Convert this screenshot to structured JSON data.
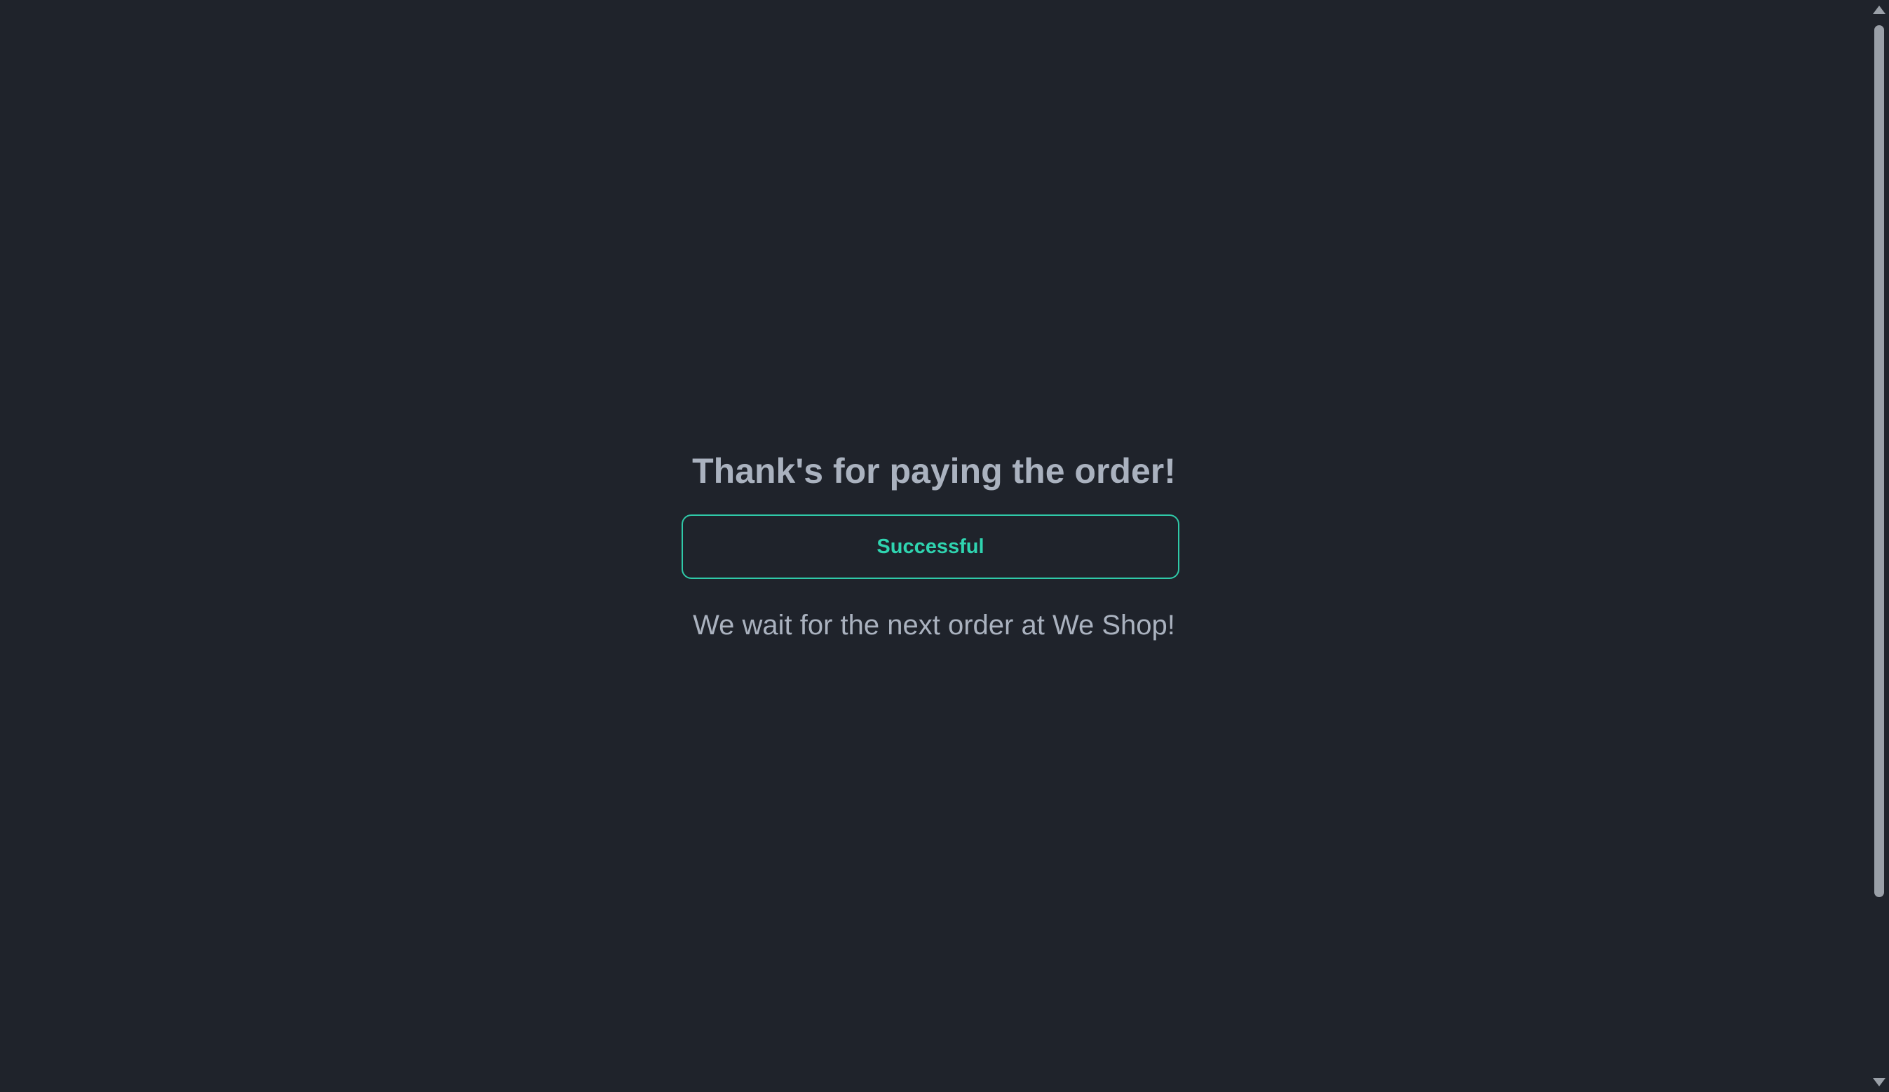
{
  "main": {
    "heading": "Thank's for paying the order!",
    "status": "Successful",
    "message": "We wait for the next order at We Shop!"
  },
  "colors": {
    "background": "#1f232b",
    "text": "#aab2bf",
    "accent": "#2fc9a8"
  },
  "icons": {
    "scroll_up": "triangle-up",
    "scroll_down": "triangle-down"
  }
}
